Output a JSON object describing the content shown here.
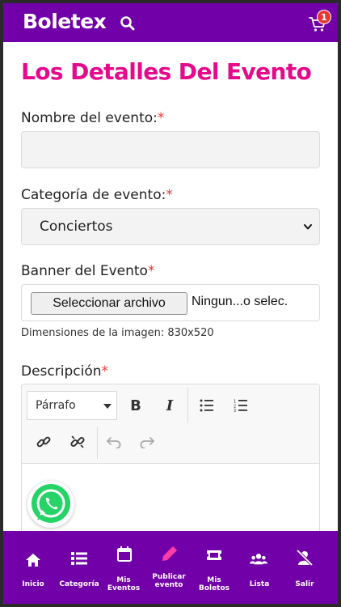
{
  "header": {
    "logo": "Boletex",
    "cart_count": "1"
  },
  "page": {
    "title": "Los Detalles Del Evento"
  },
  "form": {
    "nombre_label": "Nombre del evento:",
    "nombre_value": "",
    "categoria_label": "Categoría de evento:",
    "categoria_value": "Conciertos",
    "banner_label": "Banner del Evento",
    "file_button": "Seleccionar archivo",
    "file_status": "Ningun...o selec.",
    "dimensions_hint": "Dimensiones de la imagen: 830x520",
    "descripcion_label": "Descripción",
    "required_mark": "*"
  },
  "editor": {
    "heading_select": "Párrafo",
    "buttons": [
      "bold",
      "italic",
      "bulleted-list",
      "numbered-list",
      "link",
      "unlink",
      "undo",
      "redo"
    ]
  },
  "bottom_nav": [
    {
      "label": "Inicio",
      "icon": "home-icon"
    },
    {
      "label": "Categoría",
      "icon": "list-icon"
    },
    {
      "label": "Mis Eventos",
      "icon": "calendar-icon"
    },
    {
      "label": "Publicar evento",
      "icon": "pen-icon"
    },
    {
      "label": "Mis Boletos",
      "icon": "ticket-icon"
    },
    {
      "label": "Lista",
      "icon": "users-icon"
    },
    {
      "label": "Salir",
      "icon": "user-slash-icon"
    }
  ],
  "colors": {
    "brand_purple": "#7200a8",
    "title_pink": "#e5098c",
    "active_nav_icon": "#ff3da6",
    "required_red": "#e53935"
  }
}
